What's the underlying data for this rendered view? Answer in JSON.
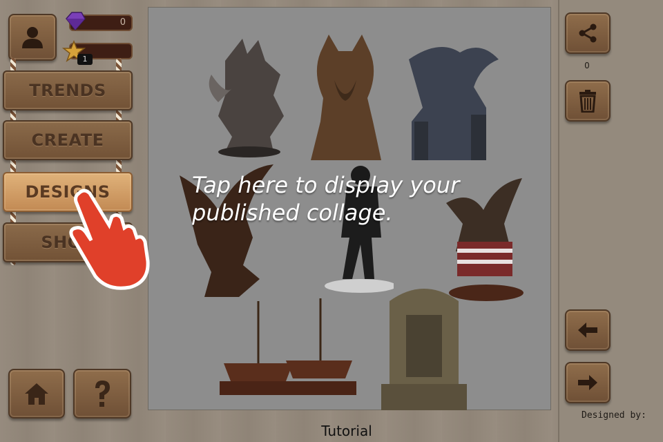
{
  "currencies": {
    "gems": "0",
    "stars_level": "1"
  },
  "menu": {
    "items": [
      {
        "label": "TRENDS"
      },
      {
        "label": "CREATE"
      },
      {
        "label": "DESIGNS"
      },
      {
        "label": "SHOP"
      }
    ]
  },
  "right_panel": {
    "share_count": "0",
    "designed_by": "Designed by:"
  },
  "tutorial": {
    "message": "Tap here to display your published collage.",
    "label": "Tutorial"
  },
  "icons": {
    "profile": "profile-icon",
    "gem": "gem-icon",
    "star": "star-icon",
    "home": "home-icon",
    "help": "help-icon",
    "share": "share-icon",
    "trash": "trash-icon",
    "arrow_left": "arrow-left-icon",
    "arrow_right": "arrow-right-icon",
    "hand_pointer": "hand-pointer-icon"
  },
  "colors": {
    "wood_dark": "#725236",
    "wood_active": "#e0b27a",
    "hand_pointer": "#e0402a",
    "overlay_text": "#ffffff"
  }
}
